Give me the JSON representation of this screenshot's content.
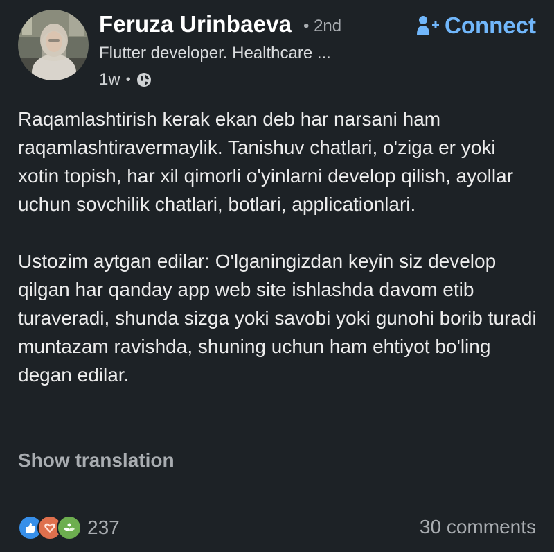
{
  "author": {
    "name": "Feruza Urinbaeva",
    "degree": "• 2nd",
    "headline": "Flutter developer. Healthcare ...",
    "time": "1w",
    "separator": "•",
    "visibility_icon": "globe-icon"
  },
  "connect": {
    "label": "Connect",
    "icon": "add-person-icon",
    "color": "#71b7fb"
  },
  "post": {
    "paragraphs": [
      "Raqamlashtirish kerak ekan deb har narsani ham raqamlashtiravermaylik. Tanishuv chatlari, o'ziga er yoki xotin topish, har xil qimorli o'yinlarni develop qilish, ayollar uchun sovchilik chatlari, botlari, applicationlari.",
      "Ustozim aytgan edilar: O'lganingizdan keyin siz develop qilgan har qanday app web site ishlashda davom etib turaveradi, shunda sizga yoki savobi yoki gunohi borib turadi muntazam ravishda, shuning uchun ham ehtiyot bo'ling degan edilar."
    ],
    "translate_label": "Show translation"
  },
  "social": {
    "reaction_icons": [
      "like-icon",
      "love-icon",
      "support-icon"
    ],
    "reaction_count": "237",
    "comments_label": "30 comments"
  },
  "colors": {
    "background": "#1d2226",
    "accent": "#71b7fb",
    "muted": "#a9adb1"
  }
}
